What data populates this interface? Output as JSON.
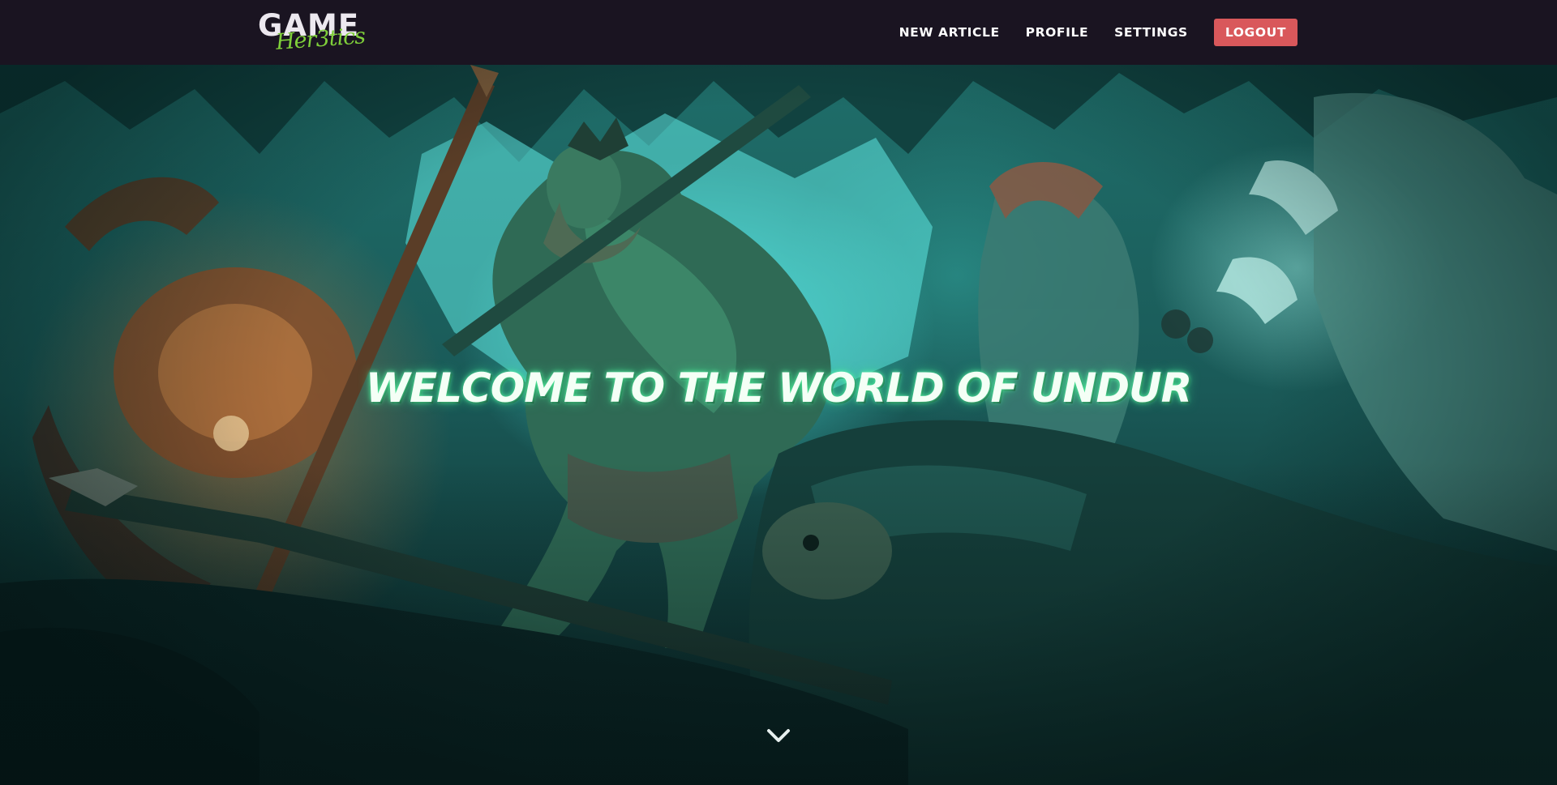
{
  "navbar": {
    "logo": {
      "main": "GAME",
      "sub": "Her3tics"
    },
    "links": [
      {
        "label": "NEW ARTICLE"
      },
      {
        "label": "PROFILE"
      },
      {
        "label": "SETTINGS"
      }
    ],
    "logout_label": "LOGOUT",
    "background_color": "#1a1421",
    "logout_color": "#d9585b"
  },
  "hero": {
    "title": "WELCOME TO THE WORLD OF UNDUR",
    "scroll_icon": "chevron-down-icon",
    "accent_color": "#3fd6c8"
  }
}
